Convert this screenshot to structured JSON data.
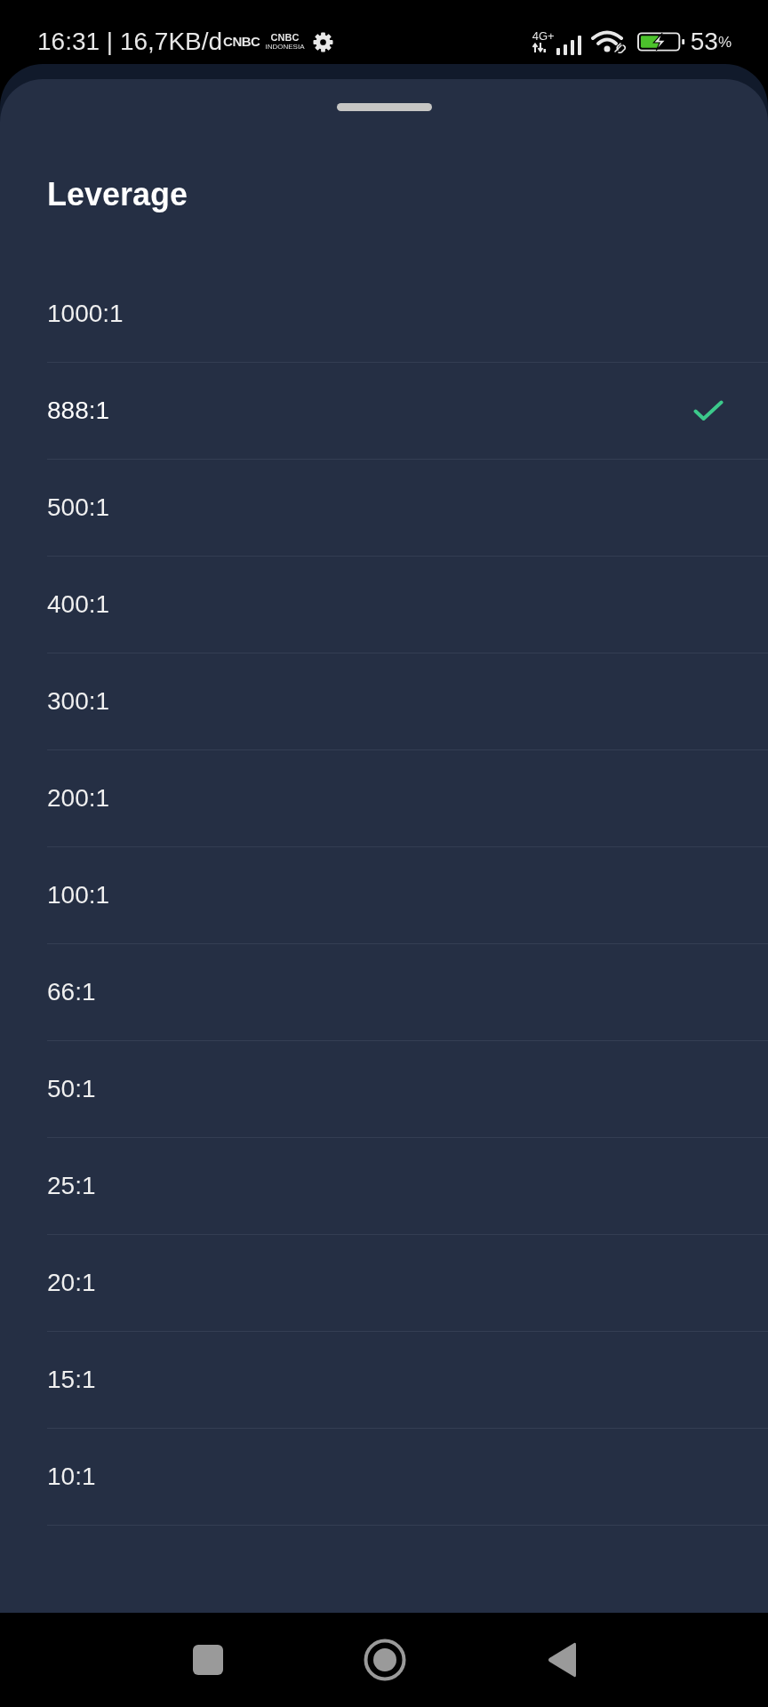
{
  "status_bar": {
    "text": "16:31 | 16,7KB/d",
    "notifications": [
      {
        "label": "CNBC"
      },
      {
        "label": "CNBC",
        "caption": "INDONESIA"
      }
    ],
    "network": "4G+",
    "charging": true,
    "battery_percent": "53",
    "battery_unit": "%"
  },
  "sheet": {
    "title": "Leverage",
    "options": [
      {
        "label": "1000:1",
        "selected": false
      },
      {
        "label": "888:1",
        "selected": true
      },
      {
        "label": "500:1",
        "selected": false
      },
      {
        "label": "400:1",
        "selected": false
      },
      {
        "label": "300:1",
        "selected": false
      },
      {
        "label": "200:1",
        "selected": false
      },
      {
        "label": "100:1",
        "selected": false
      },
      {
        "label": "66:1",
        "selected": false
      },
      {
        "label": "50:1",
        "selected": false
      },
      {
        "label": "25:1",
        "selected": false
      },
      {
        "label": "20:1",
        "selected": false
      },
      {
        "label": "15:1",
        "selected": false
      },
      {
        "label": "10:1",
        "selected": false
      }
    ]
  }
}
